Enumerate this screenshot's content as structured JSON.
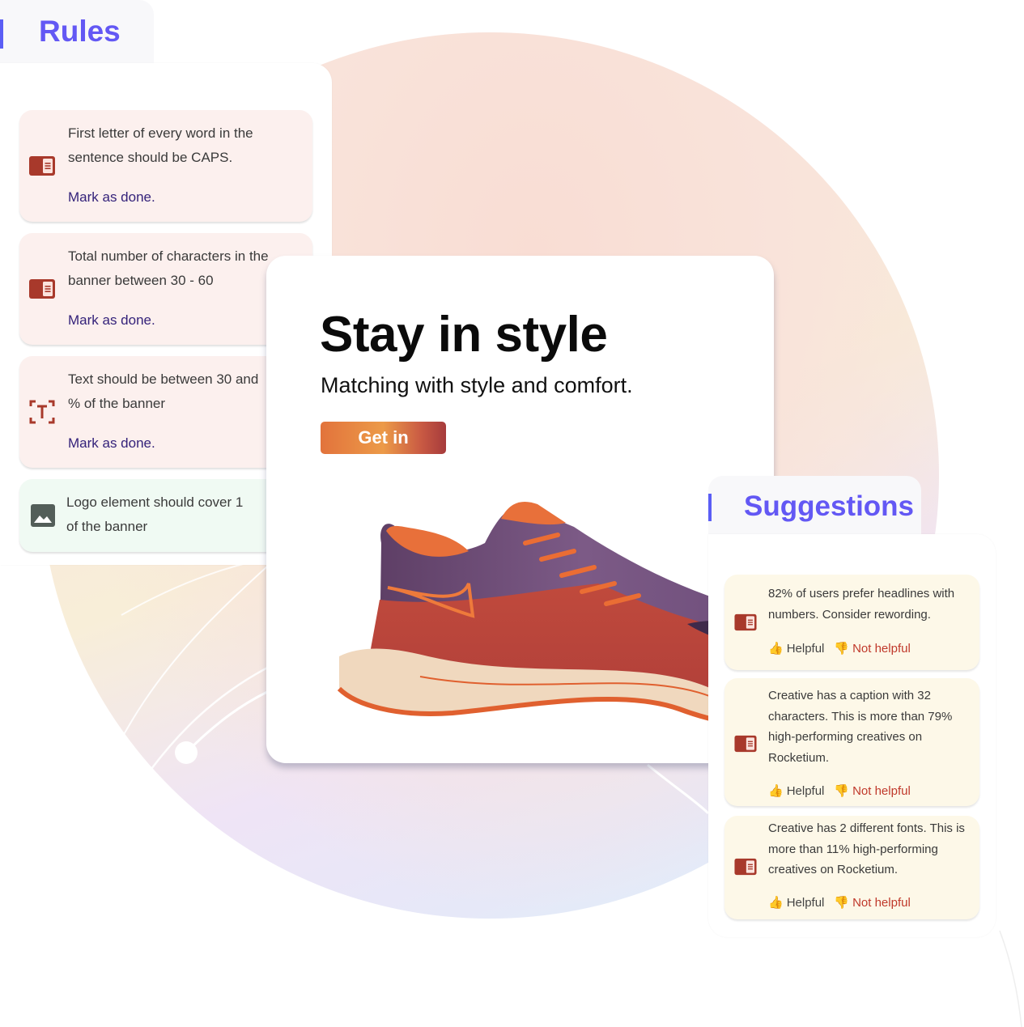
{
  "rules": {
    "title": "Rules",
    "items": [
      {
        "icon": "text-card-icon",
        "text": "First letter of every word in the\nsentence should be CAPS.",
        "action": "Mark as done.",
        "status": "pending"
      },
      {
        "icon": "text-card-icon",
        "text": "Total number of characters in the\nbanner between 30 - 60",
        "action": "Mark as done.",
        "status": "pending"
      },
      {
        "icon": "text-frame-icon",
        "text": "Text should be between 30 and\n% of the banner",
        "action": "Mark as done.",
        "status": "pending"
      },
      {
        "icon": "image-icon",
        "text": "Logo element should cover 1\nof the banner",
        "status": "passed"
      }
    ]
  },
  "banner": {
    "headline": "Stay in style",
    "subheadline": "Matching with style and comfort.",
    "cta_label": "Get in",
    "image": "running-shoe"
  },
  "suggestions": {
    "title": "Suggestions",
    "items": [
      {
        "text": "82% of users prefer headlines with numbers. Consider rewording.",
        "helpful": "Helpful",
        "not_helpful": "Not helpful"
      },
      {
        "text": "Creative has a caption with 32 characters. This is more than 79% high-performing creatives on Rocketium.",
        "helpful": "Helpful",
        "not_helpful": "Not helpful"
      },
      {
        "text": "Creative has 2 different fonts. This is more than 11% high-performing creatives on Rocketium.",
        "helpful": "Helpful",
        "not_helpful": "Not helpful"
      }
    ]
  },
  "colors": {
    "accent": "#6358f4",
    "rule_card_bg": "#fcf0ee",
    "rule_pass_bg": "#f0faf3",
    "suggestion_bg": "#fdf8e8",
    "icon_red": "#a8392b",
    "link_purple": "#34227a",
    "not_helpful_red": "#c0392b",
    "thumb_orange": "#ee8d3a"
  }
}
